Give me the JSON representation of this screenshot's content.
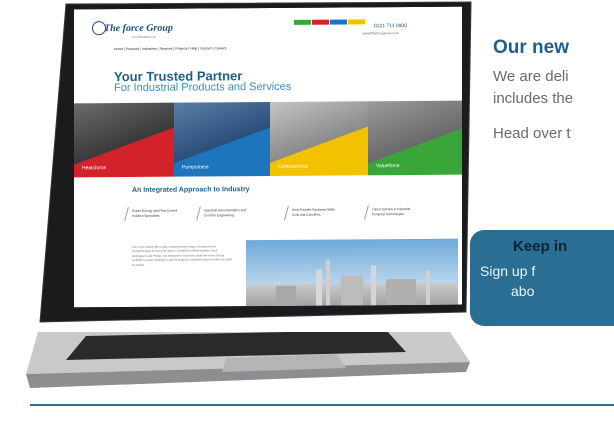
{
  "page": {
    "headline": "Our new",
    "paragraph1_line1": "We are deli",
    "paragraph1_line2": "includes the",
    "paragraph2": "Head over t",
    "cta": {
      "title": "Keep in",
      "line1": "Sign up f",
      "line2": "abo"
    }
  },
  "laptop_screen": {
    "logo_text": "The force Group",
    "logo_sub": "of Companies Ltd",
    "phone": "0121 711 0900",
    "email": "sales@theforcegroup.co.uk",
    "nav_items": [
      "Home",
      "Products",
      "Industries",
      "Services",
      "Projects",
      "Help",
      "Contact",
      "Careers"
    ],
    "hero_title": "Your Trusted Partner",
    "hero_subtitle": "For Industrial Products and Services",
    "banner_panels": [
      {
        "label": "Heatsforce",
        "color": "#d2232a"
      },
      {
        "label": "Pumpsforce",
        "color": "#1d75bc"
      },
      {
        "label": "Controlsforce",
        "color": "#f2c200"
      },
      {
        "label": "Valueforce",
        "color": "#3aa63a"
      }
    ],
    "section_title": "An Integrated Approach to Industry",
    "features": [
      "Expert Energy and Flow Control Solution Specialists",
      "Industrial Instrumentation and Controls Engineering",
      "Heat Transfer Packages Skids Coils and Calorifiers",
      "Latest Science in Industrial Pumping Technologies"
    ],
    "body_text": "The Force Group offer a fully comprehensive range of products and complementary services for Valves, Controls & Instrumentation, Heat Exchangers and Pumps. We bring these resources under the Force Group umbrella to make working on specific projects a seamless process with one point of contact.",
    "tab_colors": [
      "#3aa63a",
      "#d2232a",
      "#1d75bc",
      "#f2c200"
    ]
  }
}
